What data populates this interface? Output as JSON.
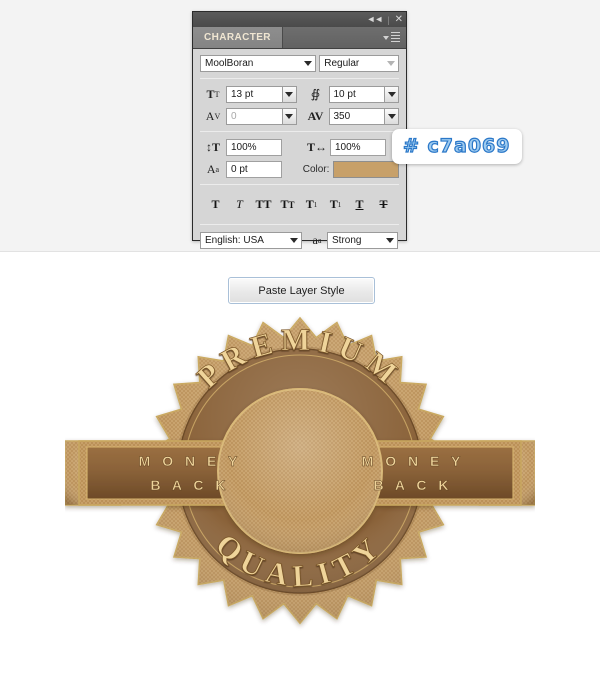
{
  "panel": {
    "title": "CHARACTER",
    "titlebar_icons": [
      "collapse-icon",
      "close-icon"
    ],
    "menu_icon": "panel-menu-icon",
    "font_family": "MoolBoran",
    "font_style": "Regular",
    "font_size": {
      "icon": "font-size-icon",
      "value": "13 pt"
    },
    "leading": {
      "icon": "leading-icon",
      "value": "10 pt"
    },
    "kerning": {
      "icon": "kerning-icon",
      "value": "0"
    },
    "tracking": {
      "icon": "tracking-icon",
      "value": "350"
    },
    "vertical_scale": {
      "icon": "vertical-scale-icon",
      "value": "100%"
    },
    "horizontal_scale": {
      "icon": "horizontal-scale-icon",
      "value": "100%"
    },
    "baseline_shift": {
      "icon": "baseline-shift-icon",
      "value": "0 pt"
    },
    "color_label": "Color:",
    "color_value": "#c7a069",
    "style_buttons": [
      {
        "name": "faux-bold-button",
        "glyph": "T"
      },
      {
        "name": "faux-italic-button",
        "glyph": "T"
      },
      {
        "name": "all-caps-button",
        "glyph": "TT"
      },
      {
        "name": "small-caps-button",
        "glyph": "Tr"
      },
      {
        "name": "superscript-button",
        "glyph": "T1"
      },
      {
        "name": "subscript-button",
        "glyph": "T1"
      },
      {
        "name": "underline-button",
        "glyph": "T"
      },
      {
        "name": "strikethrough-button",
        "glyph": "T"
      }
    ],
    "language": "English: USA",
    "antialias_icon": "anti-alias-icon",
    "antialias": "Strong"
  },
  "callout": {
    "hex": "# c7a069"
  },
  "bottom": {
    "paste_layer_style_label": "Paste Layer Style"
  },
  "badge": {
    "top_text": "PREMIUM",
    "bottom_text": "QUALITY",
    "ribbon_left_line1": "M O N E Y",
    "ribbon_left_line2": "B A C K",
    "ribbon_right_line1": "M O N E Y",
    "ribbon_right_line2": "B A C K",
    "colors": {
      "tan": "#c7a069",
      "tan_dark": "#b5874f",
      "brown": "#8a6239",
      "brown_dark": "#6f4c2a",
      "gold": "#e8c98d",
      "gold_line": "#d8b56f"
    }
  }
}
